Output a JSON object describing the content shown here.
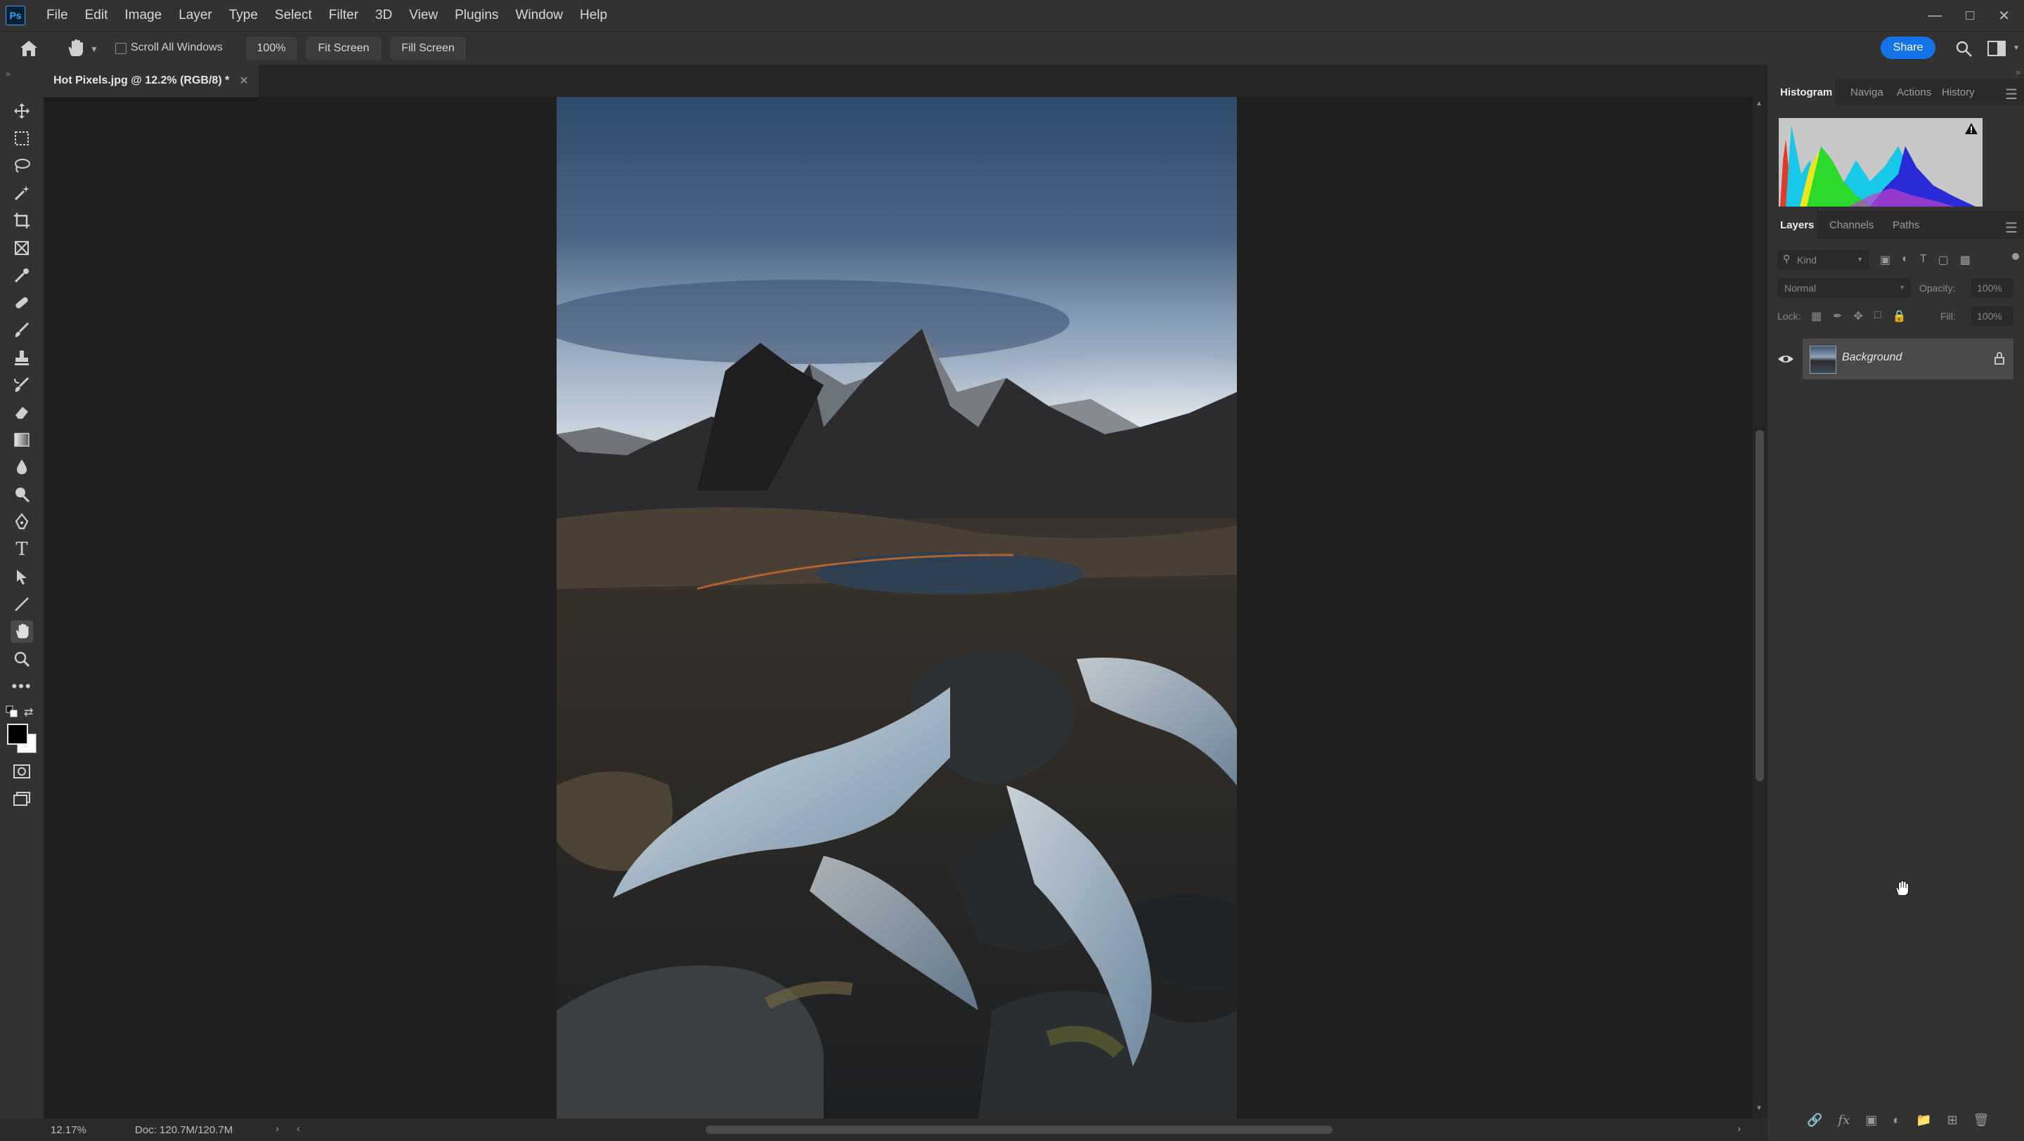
{
  "app": {
    "logo": "Ps"
  },
  "menu": [
    "File",
    "Edit",
    "Image",
    "Layer",
    "Type",
    "Select",
    "Filter",
    "3D",
    "View",
    "Plugins",
    "Window",
    "Help"
  ],
  "options": {
    "scroll_all_windows": "Scroll All Windows",
    "zoom_100": "100%",
    "fit_screen": "Fit Screen",
    "fill_screen": "Fill Screen",
    "share": "Share"
  },
  "document": {
    "tab_title": "Hot Pixels.jpg @ 12.2% (RGB/8) *"
  },
  "status": {
    "zoom": "12.17%",
    "doc": "Doc: 120.7M/120.7M"
  },
  "panels": {
    "top_tabs": [
      "Histogram",
      "Naviga",
      "Actions",
      "History"
    ],
    "layer_tabs": [
      "Layers",
      "Channels",
      "Paths"
    ],
    "filter_kind": "Kind",
    "blend_mode": "Normal",
    "opacity_label": "Opacity:",
    "opacity_value": "100%",
    "lock_label": "Lock:",
    "fill_label": "Fill:",
    "fill_value": "100%",
    "layer_name": "Background"
  },
  "colors": {
    "accent": "#1473e6",
    "panel": "#323232",
    "canvas": "#1e1e1e"
  }
}
